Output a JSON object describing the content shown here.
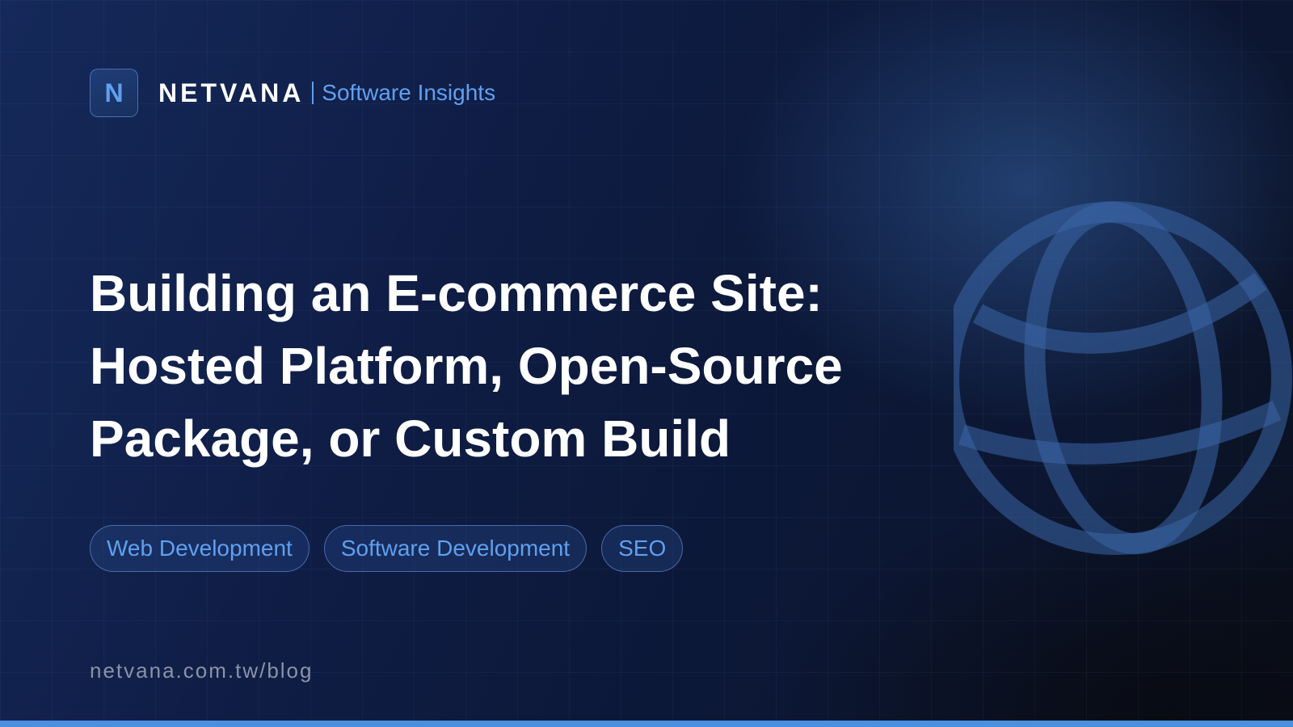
{
  "brand": {
    "logo_letter": "N",
    "name": "NETVANA",
    "tagline": "Software Insights"
  },
  "title": {
    "lines": [
      "Building an E-commerce Site:",
      "Hosted Platform, Open-Source",
      "Package, or Custom Build"
    ]
  },
  "tags": [
    {
      "label": "Web Development"
    },
    {
      "label": "Software Development"
    },
    {
      "label": "SEO"
    }
  ],
  "footer": {
    "url": "netvana.com.tw/blog"
  },
  "decor": {
    "globe_icon": "globe-icon"
  },
  "colors": {
    "accent": "#5fa0f0",
    "background": "#0f1d45",
    "bottom_bar": "#4a8fe0",
    "title": "#ffffff",
    "url": "#8a93a6"
  }
}
